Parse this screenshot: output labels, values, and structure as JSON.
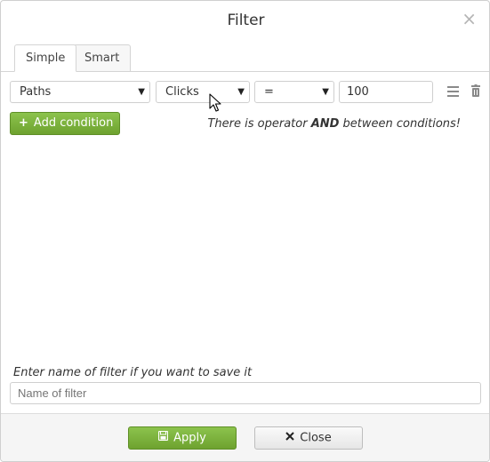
{
  "dialog": {
    "title": "Filter",
    "close_symbol": "×"
  },
  "tabs": [
    {
      "label": "Simple",
      "active": true
    },
    {
      "label": "Smart",
      "active": false
    }
  ],
  "condition": {
    "field": "Paths",
    "metric": "Clicks",
    "operator": "=",
    "value": "100"
  },
  "add_condition_label": "Add condition",
  "operator_note": {
    "prefix": "There is operator ",
    "operator": "AND",
    "suffix": " between conditions!"
  },
  "save": {
    "hint": "Enter name of filter if you want to save it",
    "placeholder": "Name of filter",
    "value": ""
  },
  "footer": {
    "apply_label": "Apply",
    "close_label": "Close"
  },
  "colors": {
    "primary_green": "#7cb33e",
    "border": "#cfcfcf"
  },
  "icons": [
    "close-icon",
    "chevron-down-icon",
    "menu-icon",
    "trash-icon",
    "plus-icon",
    "save-icon",
    "x-icon"
  ]
}
